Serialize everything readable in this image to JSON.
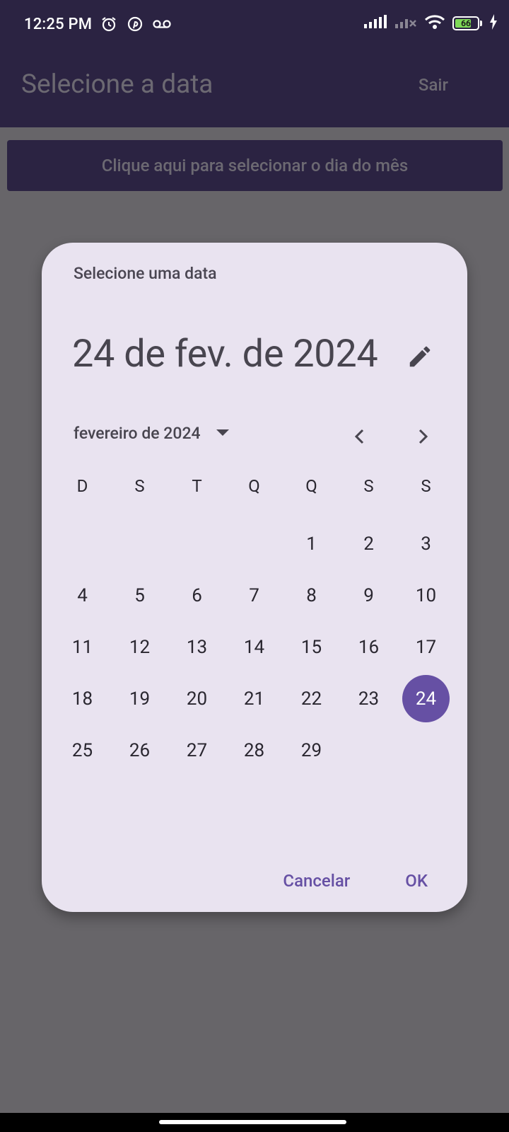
{
  "status": {
    "time": "12:25 PM",
    "icons_left": [
      "alarm-icon",
      "pinterest-icon",
      "voicemail-icon"
    ],
    "icons_right": [
      "signal-icon",
      "signal-off-icon",
      "wifi-icon",
      "battery-icon",
      "charging-icon"
    ],
    "battery": "66"
  },
  "appbar": {
    "title": "Selecione a data",
    "exit_label": "Sair"
  },
  "main": {
    "select_day_button": "Clique aqui para selecionar o dia do mês"
  },
  "dialog": {
    "headline": "Selecione uma data",
    "selected_date": "24 de fev. de 2024",
    "month_label": "fevereiro de 2024",
    "weekdays": [
      "D",
      "S",
      "T",
      "Q",
      "Q",
      "S",
      "S"
    ],
    "weeks": [
      [
        "",
        "",
        "",
        "",
        "1",
        "2",
        "3"
      ],
      [
        "4",
        "5",
        "6",
        "7",
        "8",
        "9",
        "10"
      ],
      [
        "11",
        "12",
        "13",
        "14",
        "15",
        "16",
        "17"
      ],
      [
        "18",
        "19",
        "20",
        "21",
        "22",
        "23",
        "24"
      ],
      [
        "25",
        "26",
        "27",
        "28",
        "29",
        "",
        ""
      ]
    ],
    "selected_day": "24",
    "cancel_label": "Cancelar",
    "ok_label": "OK"
  },
  "colors": {
    "appbar": "#2b2342",
    "scrim": "#676569",
    "dialog_bg": "#e9e3f0",
    "accent": "#6650a4"
  }
}
